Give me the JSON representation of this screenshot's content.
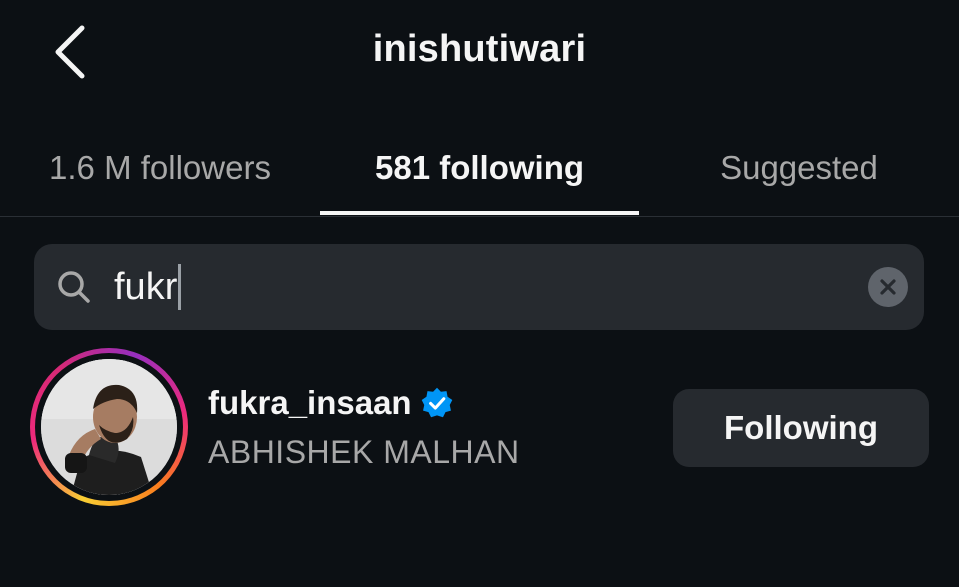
{
  "header": {
    "title": "inishutiwari",
    "back_icon": "chevron-left-icon"
  },
  "tabs": [
    {
      "label": "1.6 M followers",
      "active": false
    },
    {
      "label": "581 following",
      "active": true
    },
    {
      "label": "Suggested",
      "active": false
    }
  ],
  "search": {
    "value": "fukr",
    "search_icon": "search-icon",
    "clear_icon": "clear-icon"
  },
  "results": [
    {
      "username": "fukra_insaan",
      "full_name": "ABHISHEK MALHAN",
      "verified": true,
      "button_label": "Following"
    }
  ],
  "colors": {
    "background": "#0c1014",
    "surface": "#262a2f",
    "text_primary": "#f5f5f5",
    "text_secondary": "#a8a8a8",
    "verified_blue": "#0095f6"
  }
}
